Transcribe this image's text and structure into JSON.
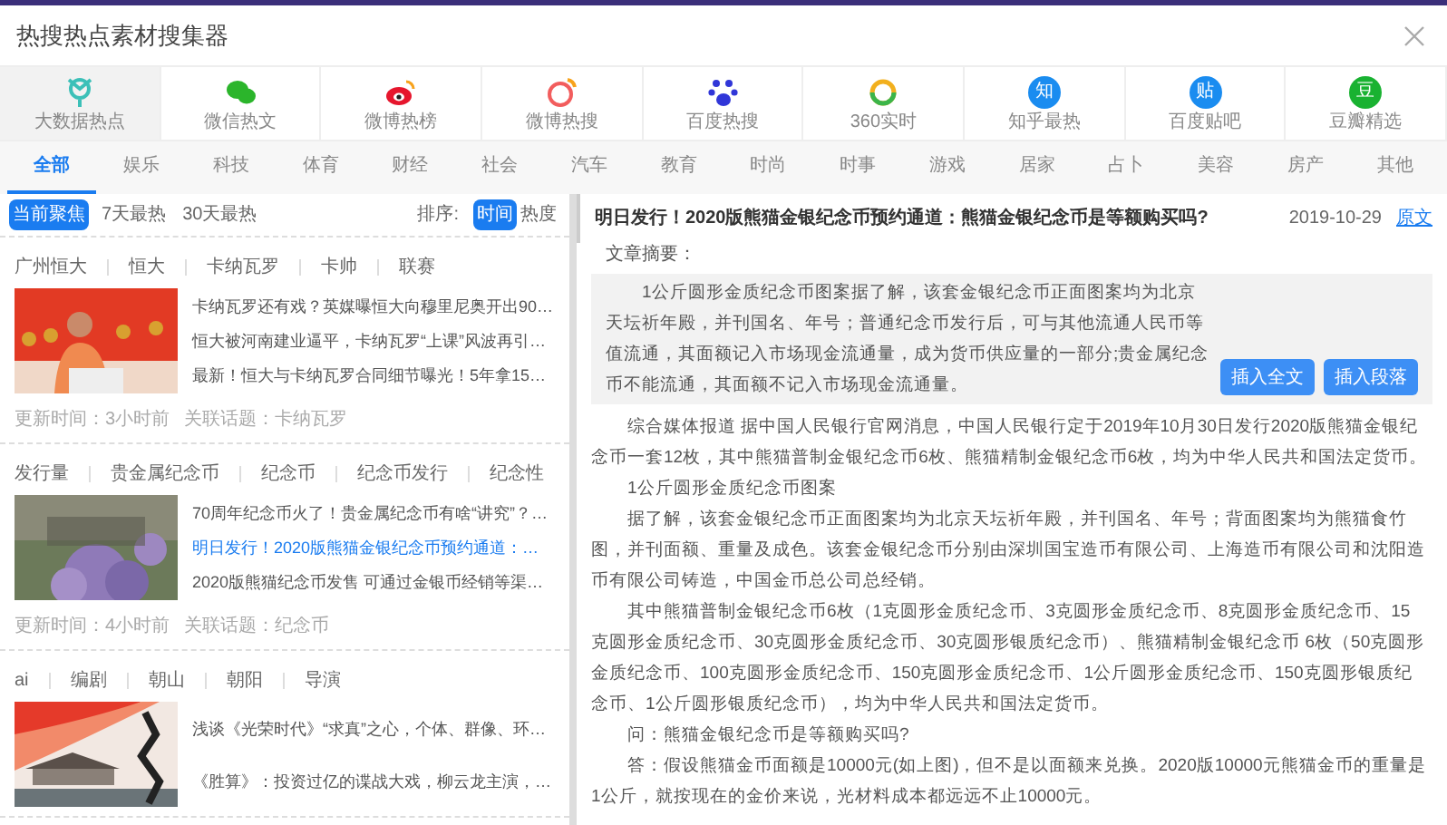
{
  "window": {
    "title": "热搜热点素材搜集器"
  },
  "sources": [
    {
      "label": "大数据热点",
      "selected": true
    },
    {
      "label": "微信热文",
      "selected": false
    },
    {
      "label": "微博热榜",
      "selected": false
    },
    {
      "label": "微博热搜",
      "selected": false
    },
    {
      "label": "百度热搜",
      "selected": false
    },
    {
      "label": "360实时",
      "selected": false
    },
    {
      "label": "知乎最热",
      "badge": "知",
      "selected": false
    },
    {
      "label": "百度贴吧",
      "badge": "贴",
      "selected": false
    },
    {
      "label": "豆瓣精选",
      "badge": "豆",
      "selected": false
    }
  ],
  "categories": [
    {
      "label": "全部",
      "selected": true
    },
    {
      "label": "娱乐",
      "selected": false
    },
    {
      "label": "科技",
      "selected": false
    },
    {
      "label": "体育",
      "selected": false
    },
    {
      "label": "财经",
      "selected": false
    },
    {
      "label": "社会",
      "selected": false
    },
    {
      "label": "汽车",
      "selected": false
    },
    {
      "label": "教育",
      "selected": false
    },
    {
      "label": "时尚",
      "selected": false
    },
    {
      "label": "时事",
      "selected": false
    },
    {
      "label": "游戏",
      "selected": false
    },
    {
      "label": "居家",
      "selected": false
    },
    {
      "label": "占卜",
      "selected": false
    },
    {
      "label": "美容",
      "selected": false
    },
    {
      "label": "房产",
      "selected": false
    },
    {
      "label": "其他",
      "selected": false
    }
  ],
  "ranges": [
    {
      "label": "当前聚焦",
      "selected": true
    },
    {
      "label": "7天最热",
      "selected": false
    },
    {
      "label": "30天最热",
      "selected": false
    }
  ],
  "sort": {
    "label": "排序:",
    "options": [
      {
        "label": "时间",
        "selected": true
      },
      {
        "label": "热度",
        "selected": false
      }
    ]
  },
  "topics": [
    {
      "tags": [
        "广州恒大",
        "恒大",
        "卡纳瓦罗",
        "卡帅",
        "联赛"
      ],
      "headlines": [
        {
          "text": "卡纳瓦罗还有戏？英媒曝恒大向穆里尼奥开出90…",
          "selected": false
        },
        {
          "text": "恒大被河南建业逼平，卡纳瓦罗“上课”风波再引…",
          "selected": false
        },
        {
          "text": "最新！恒大与卡纳瓦罗合同细节曝光！5年拿15…",
          "selected": false
        }
      ],
      "updated": "更新时间：3小时前",
      "related": "关联话题：卡纳瓦罗"
    },
    {
      "tags": [
        "发行量",
        "贵金属纪念币",
        "纪念币",
        "纪念币发行",
        "纪念性"
      ],
      "headlines": [
        {
          "text": "70周年纪念币火了！贵金属纪念币有啥“讲究”？…",
          "selected": false
        },
        {
          "text": "明日发行！2020版熊猫金银纪念币预约通道：…",
          "selected": true
        },
        {
          "text": "2020版熊猫纪念币发售 可通过金银币经销等渠…",
          "selected": false
        }
      ],
      "updated": "更新时间：4小时前",
      "related": "关联话题：纪念币"
    },
    {
      "tags": [
        "ai",
        "编剧",
        "朝山",
        "朝阳",
        "导演"
      ],
      "headlines": [
        {
          "text": "浅谈《光荣时代》“求真”之心，个体、群像、环…",
          "selected": false
        },
        {
          "text": "《胜算》：投资过亿的谍战大戏，柳云龙主演，…",
          "selected": false
        }
      ]
    }
  ],
  "article": {
    "title": "明日发行！2020版熊猫金银纪念币预约通道：熊猫金银纪念币是等额购买吗?",
    "date": "2019-10-29",
    "source_link": "原文",
    "summary_label": "文章摘要：",
    "summary": "1公斤圆形金质纪念币图案据了解，该套金银纪念币正面图案均为北京天坛祈年殿，并刊国名、年号；普通纪念币发行后，可与其他流通人民币等值流通，其面额记入市场现金流通量，成为货币供应量的一部分;贵金属纪念币不能流通，其面额不记入市场现金流通量。",
    "buttons": [
      "插入全文",
      "插入段落"
    ],
    "paragraphs": [
      "综合媒体报道 据中国人民银行官网消息，中国人民银行定于2019年10月30日发行2020版熊猫金银纪念币一套12枚，其中熊猫普制金银纪念币6枚、熊猫精制金银纪念币6枚，均为中华人民共和国法定货币。",
      "1公斤圆形金质纪念币图案",
      "据了解，该套金银纪念币正面图案均为北京天坛祈年殿，并刊国名、年号；背面图案均为熊猫食竹图，并刊面额、重量及成色。该套金银纪念币分别由深圳国宝造币有限公司、上海造币有限公司和沈阳造币有限公司铸造，中国金币总公司总经销。",
      "其中熊猫普制金银纪念币6枚（1克圆形金质纪念币、3克圆形金质纪念币、8克圆形金质纪念币、15 克圆形金质纪念币、30克圆形金质纪念币、30克圆形银质纪念币）、熊猫精制金银纪念币 6枚（50克圆形金质纪念币、100克圆形金质纪念币、150克圆形金质纪念币、1公斤圆形金质纪念币、150克圆形银质纪念币、1公斤圆形银质纪念币），均为中华人民共和国法定货币。",
      "问：熊猫金银纪念币是等额购买吗?",
      "答：假设熊猫金币面额是10000元(如上图)，但不是以面额来兑换。2020版10000元熊猫金币的重量是1公斤，就按现在的金价来说，光材料成本都远远不止10000元。"
    ]
  }
}
